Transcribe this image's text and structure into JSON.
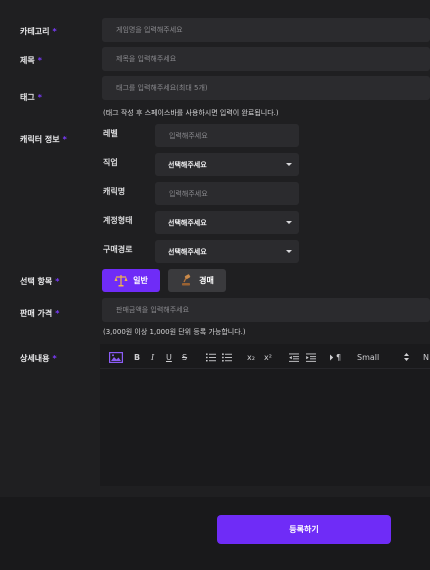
{
  "form": {
    "category": {
      "label": "카테고리",
      "placeholder": "게임명을 입력해주세요"
    },
    "title": {
      "label": "제목",
      "placeholder": "제목을 입력해주세요"
    },
    "tags": {
      "label": "태그",
      "placeholder": "태그를 입력해주세요(최대 5개)",
      "note": "(태그 작성 후 스페이스바를 사용하시면 입력이 완료됩니다.)"
    },
    "character": {
      "label": "캐릭터 정보",
      "level": {
        "label": "레벨",
        "placeholder": "입력해주세요"
      },
      "job": {
        "label": "직업",
        "value": "선택해주세요"
      },
      "name": {
        "label": "캐릭명",
        "placeholder": "입력해주세요"
      },
      "account_type": {
        "label": "계정형태",
        "value": "선택해주세요"
      },
      "purchase_route": {
        "label": "구매경로",
        "value": "선택해주세요"
      }
    },
    "selection": {
      "label": "선택 항목",
      "options": [
        "일반",
        "경매"
      ],
      "selected": "일반"
    },
    "price": {
      "label": "판매 가격",
      "placeholder": "판매금액을 입력해주세요",
      "note": "(3,000원 이상 1,000원 단위 등록 가능합니다.)"
    },
    "details": {
      "label": "상세내용",
      "toolbar": {
        "bold": "B",
        "italic": "I",
        "underline": "U",
        "strike": "S",
        "subscript": "x₂",
        "superscript": "x²",
        "paragraph": "¶",
        "size": "Small",
        "font_partial": "N"
      }
    },
    "submit_label": "등록하기",
    "required_mark": "*"
  },
  "colors": {
    "accent": "#6f2cf7",
    "background": "#1f1f21",
    "field": "#2b2b2e"
  },
  "icons": [
    "image-icon",
    "bullet-list-icon",
    "numbered-list-icon",
    "indent-icon",
    "outdent-icon",
    "paragraph-icon",
    "scale-icon",
    "gavel-icon",
    "chevron-down-icon"
  ]
}
